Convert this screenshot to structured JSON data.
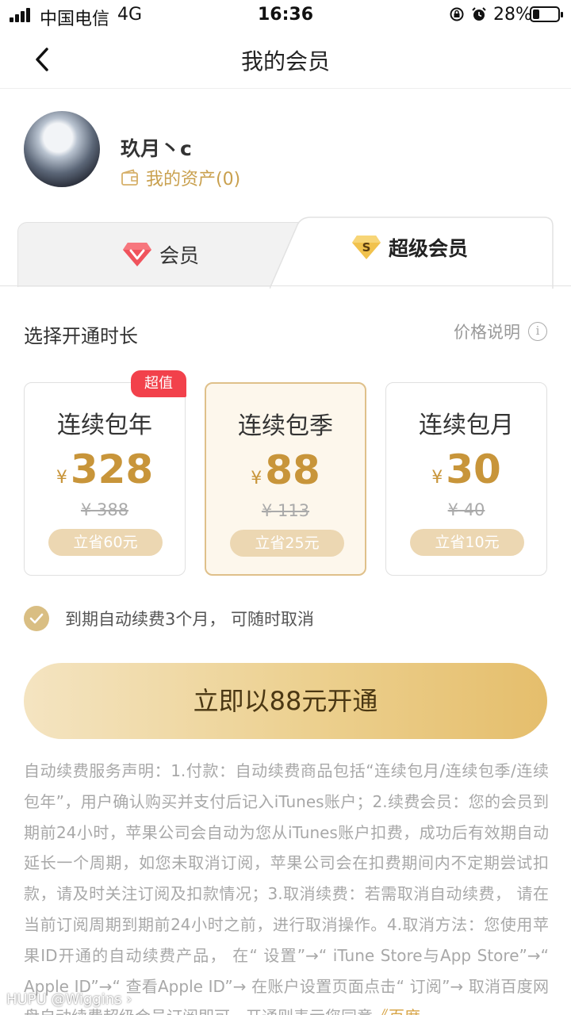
{
  "status_bar": {
    "carrier": "中国电信",
    "network": "4G",
    "time": "16:36",
    "battery_percent_text": "28%",
    "battery_level": 0.28,
    "icons": [
      "signal-icon",
      "orientation-lock-icon",
      "alarm-icon",
      "battery-icon"
    ]
  },
  "nav": {
    "title": "我的会员",
    "back_icon": "chevron-left-icon"
  },
  "profile": {
    "username": "玖月丶c",
    "assets_label": "我的资产(0)",
    "assets_icon": "wallet-icon"
  },
  "tabs": [
    {
      "label": "会员",
      "icon": "diamond-icon",
      "selected": false
    },
    {
      "label": "超级会员",
      "icon": "super-s-icon",
      "selected": true
    }
  ],
  "duration": {
    "title": "选择开通时长",
    "price_info_label": "价格说明",
    "info_icon": "info-icon"
  },
  "plans": [
    {
      "name": "连续包年",
      "currency": "¥",
      "price": "328",
      "original": "¥ 388",
      "save": "立省60元",
      "badge": "超值",
      "selected": false
    },
    {
      "name": "连续包季",
      "currency": "¥",
      "price": "88",
      "original": "¥ 113",
      "save": "立省25元",
      "badge": "",
      "selected": true
    },
    {
      "name": "连续包月",
      "currency": "¥",
      "price": "30",
      "original": "¥ 40",
      "save": "立省10元",
      "badge": "",
      "selected": false
    }
  ],
  "auto_renew": {
    "checked": true,
    "text": "到期自动续费3个月， 可随时取消"
  },
  "cta": {
    "label": "立即以88元开通"
  },
  "legal": {
    "text": "自动续费服务声明：1.付款：自动续费商品包括“连续包月/连续包季/连续包年”，用户确认购买并支付后记入iTunes账户；2.续费会员：您的会员到期前24小时，苹果公司会自动为您从iTunes账户扣费，成功后有效期自动延长一个周期，如您未取消订阅，苹果公司会在扣费期间内不定期尝试扣款，请及时关注订阅及扣款情况；3.取消续费：若需取消自动续费， 请在当前订阅周期到期前24小时之前，进行取消操作。4.取消方法：您使用苹果ID开通的自动续费产品， 在“ 设置”→“ iTune Store与App Store”→“ Apple ID”→“ 查看Apple ID”→ 在账户设置页面点击“ 订阅”→ 取消百度网盘自动续费超级会员订阅即可。开通则表示您同意",
    "link": "《百度"
  },
  "colors": {
    "gold": "#c8953a",
    "gold_light": "#ecd7b2",
    "selected_bg": "#fdf7ec",
    "badge_red": "#f2414b",
    "cta_gradient_start": "#f4e4c1",
    "cta_gradient_end": "#e5be6c"
  },
  "watermark": "HUPU @Wiggins ›"
}
